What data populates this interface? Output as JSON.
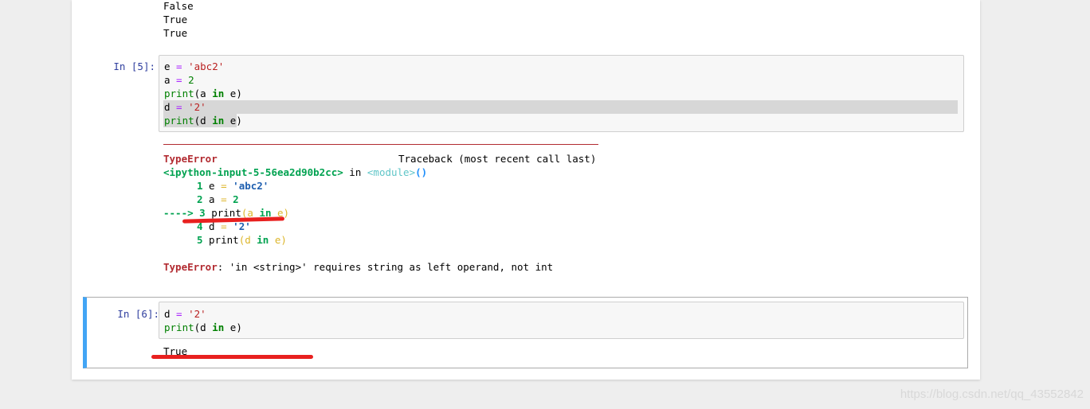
{
  "top_output": [
    "False",
    "True",
    "True"
  ],
  "cell5": {
    "prompt": "In [5]:",
    "code": {
      "l1": {
        "var": "e",
        "eq": " = ",
        "str": "'abc2'"
      },
      "l2": {
        "var": "a",
        "eq": " = ",
        "num": "2"
      },
      "l3": {
        "fn": "print",
        "pre": "(a ",
        "kw": "in",
        "post": " e)"
      },
      "l4": {
        "var": "d",
        "eq": " = ",
        "str": "'2'"
      },
      "l5": {
        "fn": "print",
        "pre": "(d ",
        "kw": "in",
        "post": " e)"
      }
    },
    "traceback": {
      "error_name": "TypeError",
      "header": "Traceback (most recent call last)",
      "source": "<ipython-input-5-56ea2d90b2cc>",
      "in_word": " in ",
      "module": "<module>",
      "parens": "()",
      "lines": [
        {
          "no": "1",
          "pre": " e ",
          "eq": "=",
          "str": " 'abc2'"
        },
        {
          "no": "2",
          "pre": " a ",
          "eq": "=",
          "num": " 2"
        },
        {
          "arrow": "---->",
          "no": "3",
          "fn": " print",
          "a": "(a ",
          "kw": "in",
          "b": " e)"
        },
        {
          "no": "4",
          "pre": " d ",
          "eq": "=",
          "str": " '2'"
        },
        {
          "no": "5",
          "fn": " print",
          "a": "(d ",
          "kw": "in",
          "b": " e)"
        }
      ],
      "message_name": "TypeError",
      "message": ": 'in <string>' requires string as left operand, not int"
    }
  },
  "cell6": {
    "prompt": "In [6]:",
    "code": {
      "l1": {
        "var": "d",
        "eq": " = ",
        "str": "'2'"
      },
      "l2": {
        "fn": "print",
        "pre": "(d ",
        "kw": "in",
        "post": " e)"
      }
    },
    "output": "True"
  },
  "watermark": "https://blog.csdn.net/qq_43552842",
  "colors": {
    "accent": "#42a5f5",
    "error": "#b22b31",
    "marker": "#e8201f"
  }
}
